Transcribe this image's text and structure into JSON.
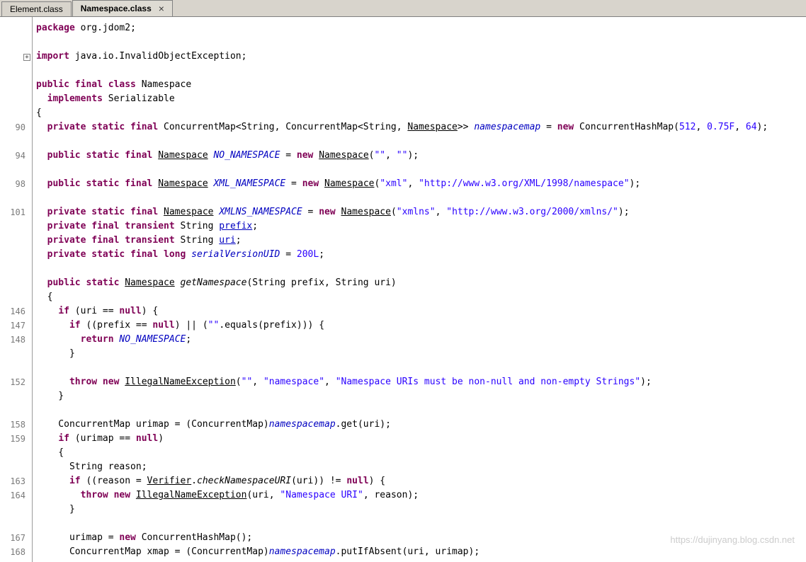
{
  "tabbar": {
    "tabs": [
      {
        "label": "Element.class",
        "active": false
      },
      {
        "label": "Namespace.class",
        "active": true
      }
    ],
    "close_glyph": "×"
  },
  "editor": {
    "expand_glyph": "+",
    "lines": [
      {
        "num": "",
        "segs": [
          {
            "s": "kw",
            "t": "package"
          },
          {
            "s": "pl",
            "t": " org.jdom2;"
          }
        ]
      },
      {
        "num": "",
        "segs": []
      },
      {
        "num": "",
        "segs": [
          {
            "s": "kw",
            "t": "import"
          },
          {
            "s": "pl",
            "t": " java.io.InvalidObjectException;"
          }
        ]
      },
      {
        "num": "",
        "segs": []
      },
      {
        "num": "",
        "segs": [
          {
            "s": "kw",
            "t": "public final class"
          },
          {
            "s": "pl",
            "t": " Namespace"
          }
        ]
      },
      {
        "num": "",
        "segs": [
          {
            "s": "pl",
            "t": "  "
          },
          {
            "s": "kw",
            "t": "implements"
          },
          {
            "s": "pl",
            "t": " Serializable"
          }
        ]
      },
      {
        "num": "",
        "segs": [
          {
            "s": "pl",
            "t": "{"
          }
        ]
      },
      {
        "num": "90",
        "segs": [
          {
            "s": "pl",
            "t": "  "
          },
          {
            "s": "kw",
            "t": "private static final"
          },
          {
            "s": "pl",
            "t": " ConcurrentMap<String, ConcurrentMap<String, "
          },
          {
            "s": "ty",
            "t": "Namespace"
          },
          {
            "s": "pl",
            "t": ">> "
          },
          {
            "s": "sf",
            "t": "namespacemap"
          },
          {
            "s": "pl",
            "t": " = "
          },
          {
            "s": "kw",
            "t": "new"
          },
          {
            "s": "pl",
            "t": " ConcurrentHashMap("
          },
          {
            "s": "num",
            "t": "512"
          },
          {
            "s": "pl",
            "t": ", "
          },
          {
            "s": "num",
            "t": "0.75F"
          },
          {
            "s": "pl",
            "t": ", "
          },
          {
            "s": "num",
            "t": "64"
          },
          {
            "s": "pl",
            "t": ");"
          }
        ]
      },
      {
        "num": "",
        "segs": []
      },
      {
        "num": "94",
        "segs": [
          {
            "s": "pl",
            "t": "  "
          },
          {
            "s": "kw",
            "t": "public static final"
          },
          {
            "s": "pl",
            "t": " "
          },
          {
            "s": "ty",
            "t": "Namespace"
          },
          {
            "s": "pl",
            "t": " "
          },
          {
            "s": "sf",
            "t": "NO_NAMESPACE"
          },
          {
            "s": "pl",
            "t": " = "
          },
          {
            "s": "kw",
            "t": "new"
          },
          {
            "s": "pl",
            "t": " "
          },
          {
            "s": "ty",
            "t": "Namespace"
          },
          {
            "s": "pl",
            "t": "("
          },
          {
            "s": "str",
            "t": "\"\""
          },
          {
            "s": "pl",
            "t": ", "
          },
          {
            "s": "str",
            "t": "\"\""
          },
          {
            "s": "pl",
            "t": ");"
          }
        ]
      },
      {
        "num": "",
        "segs": []
      },
      {
        "num": "98",
        "segs": [
          {
            "s": "pl",
            "t": "  "
          },
          {
            "s": "kw",
            "t": "public static final"
          },
          {
            "s": "pl",
            "t": " "
          },
          {
            "s": "ty",
            "t": "Namespace"
          },
          {
            "s": "pl",
            "t": " "
          },
          {
            "s": "sf",
            "t": "XML_NAMESPACE"
          },
          {
            "s": "pl",
            "t": " = "
          },
          {
            "s": "kw",
            "t": "new"
          },
          {
            "s": "pl",
            "t": " "
          },
          {
            "s": "ty",
            "t": "Namespace"
          },
          {
            "s": "pl",
            "t": "("
          },
          {
            "s": "str",
            "t": "\"xml\""
          },
          {
            "s": "pl",
            "t": ", "
          },
          {
            "s": "str",
            "t": "\"http://www.w3.org/XML/1998/namespace\""
          },
          {
            "s": "pl",
            "t": ");"
          }
        ]
      },
      {
        "num": "",
        "segs": []
      },
      {
        "num": "101",
        "segs": [
          {
            "s": "pl",
            "t": "  "
          },
          {
            "s": "kw",
            "t": "private static final"
          },
          {
            "s": "pl",
            "t": " "
          },
          {
            "s": "ty",
            "t": "Namespace"
          },
          {
            "s": "pl",
            "t": " "
          },
          {
            "s": "sf",
            "t": "XMLNS_NAMESPACE"
          },
          {
            "s": "pl",
            "t": " = "
          },
          {
            "s": "kw",
            "t": "new"
          },
          {
            "s": "pl",
            "t": " "
          },
          {
            "s": "ty",
            "t": "Namespace"
          },
          {
            "s": "pl",
            "t": "("
          },
          {
            "s": "str",
            "t": "\"xmlns\""
          },
          {
            "s": "pl",
            "t": ", "
          },
          {
            "s": "str",
            "t": "\"http://www.w3.org/2000/xmlns/\""
          },
          {
            "s": "pl",
            "t": ");"
          }
        ]
      },
      {
        "num": "",
        "segs": [
          {
            "s": "pl",
            "t": "  "
          },
          {
            "s": "kw",
            "t": "private final transient"
          },
          {
            "s": "pl",
            "t": " String "
          },
          {
            "s": "if",
            "t": "prefix"
          },
          {
            "s": "pl",
            "t": ";"
          }
        ]
      },
      {
        "num": "",
        "segs": [
          {
            "s": "pl",
            "t": "  "
          },
          {
            "s": "kw",
            "t": "private final transient"
          },
          {
            "s": "pl",
            "t": " String "
          },
          {
            "s": "if",
            "t": "uri"
          },
          {
            "s": "pl",
            "t": ";"
          }
        ]
      },
      {
        "num": "",
        "segs": [
          {
            "s": "pl",
            "t": "  "
          },
          {
            "s": "kw",
            "t": "private static final long"
          },
          {
            "s": "pl",
            "t": " "
          },
          {
            "s": "sf",
            "t": "serialVersionUID"
          },
          {
            "s": "pl",
            "t": " = "
          },
          {
            "s": "num",
            "t": "200L"
          },
          {
            "s": "pl",
            "t": ";"
          }
        ]
      },
      {
        "num": "",
        "segs": []
      },
      {
        "num": "",
        "segs": [
          {
            "s": "pl",
            "t": "  "
          },
          {
            "s": "kw",
            "t": "public static"
          },
          {
            "s": "pl",
            "t": " "
          },
          {
            "s": "ty",
            "t": "Namespace"
          },
          {
            "s": "pl",
            "t": " "
          },
          {
            "s": "sm",
            "t": "getNamespace"
          },
          {
            "s": "pl",
            "t": "(String prefix, String uri)"
          }
        ]
      },
      {
        "num": "",
        "segs": [
          {
            "s": "pl",
            "t": "  {"
          }
        ]
      },
      {
        "num": "146",
        "segs": [
          {
            "s": "pl",
            "t": "    "
          },
          {
            "s": "kw",
            "t": "if"
          },
          {
            "s": "pl",
            "t": " (uri == "
          },
          {
            "s": "kw",
            "t": "null"
          },
          {
            "s": "pl",
            "t": ") {"
          }
        ]
      },
      {
        "num": "147",
        "segs": [
          {
            "s": "pl",
            "t": "      "
          },
          {
            "s": "kw",
            "t": "if"
          },
          {
            "s": "pl",
            "t": " ((prefix == "
          },
          {
            "s": "kw",
            "t": "null"
          },
          {
            "s": "pl",
            "t": ") || ("
          },
          {
            "s": "str",
            "t": "\"\""
          },
          {
            "s": "pl",
            "t": ".equals(prefix))) {"
          }
        ]
      },
      {
        "num": "148",
        "segs": [
          {
            "s": "pl",
            "t": "        "
          },
          {
            "s": "kw",
            "t": "return"
          },
          {
            "s": "pl",
            "t": " "
          },
          {
            "s": "sf",
            "t": "NO_NAMESPACE"
          },
          {
            "s": "pl",
            "t": ";"
          }
        ]
      },
      {
        "num": "",
        "segs": [
          {
            "s": "pl",
            "t": "      }"
          }
        ]
      },
      {
        "num": "",
        "segs": []
      },
      {
        "num": "152",
        "segs": [
          {
            "s": "pl",
            "t": "      "
          },
          {
            "s": "kw",
            "t": "throw new"
          },
          {
            "s": "pl",
            "t": " "
          },
          {
            "s": "ty",
            "t": "IllegalNameException"
          },
          {
            "s": "pl",
            "t": "("
          },
          {
            "s": "str",
            "t": "\"\""
          },
          {
            "s": "pl",
            "t": ", "
          },
          {
            "s": "str",
            "t": "\"namespace\""
          },
          {
            "s": "pl",
            "t": ", "
          },
          {
            "s": "str",
            "t": "\"Namespace URIs must be non-null and non-empty Strings\""
          },
          {
            "s": "pl",
            "t": ");"
          }
        ]
      },
      {
        "num": "",
        "segs": [
          {
            "s": "pl",
            "t": "    }"
          }
        ]
      },
      {
        "num": "",
        "segs": []
      },
      {
        "num": "158",
        "segs": [
          {
            "s": "pl",
            "t": "    ConcurrentMap urimap = (ConcurrentMap)"
          },
          {
            "s": "sf",
            "t": "namespacemap"
          },
          {
            "s": "pl",
            "t": ".get(uri);"
          }
        ]
      },
      {
        "num": "159",
        "segs": [
          {
            "s": "pl",
            "t": "    "
          },
          {
            "s": "kw",
            "t": "if"
          },
          {
            "s": "pl",
            "t": " (urimap == "
          },
          {
            "s": "kw",
            "t": "null"
          },
          {
            "s": "pl",
            "t": ")"
          }
        ]
      },
      {
        "num": "",
        "segs": [
          {
            "s": "pl",
            "t": "    {"
          }
        ]
      },
      {
        "num": "",
        "segs": [
          {
            "s": "pl",
            "t": "      String reason;"
          }
        ]
      },
      {
        "num": "163",
        "segs": [
          {
            "s": "pl",
            "t": "      "
          },
          {
            "s": "kw",
            "t": "if"
          },
          {
            "s": "pl",
            "t": " ((reason = "
          },
          {
            "s": "ty",
            "t": "Verifier"
          },
          {
            "s": "pl",
            "t": "."
          },
          {
            "s": "sm",
            "t": "checkNamespaceURI"
          },
          {
            "s": "pl",
            "t": "(uri)) != "
          },
          {
            "s": "kw",
            "t": "null"
          },
          {
            "s": "pl",
            "t": ") {"
          }
        ]
      },
      {
        "num": "164",
        "segs": [
          {
            "s": "pl",
            "t": "        "
          },
          {
            "s": "kw",
            "t": "throw new"
          },
          {
            "s": "pl",
            "t": " "
          },
          {
            "s": "ty",
            "t": "IllegalNameException"
          },
          {
            "s": "pl",
            "t": "(uri, "
          },
          {
            "s": "str",
            "t": "\"Namespace URI\""
          },
          {
            "s": "pl",
            "t": ", reason);"
          }
        ]
      },
      {
        "num": "",
        "segs": [
          {
            "s": "pl",
            "t": "      }"
          }
        ]
      },
      {
        "num": "",
        "segs": []
      },
      {
        "num": "167",
        "segs": [
          {
            "s": "pl",
            "t": "      urimap = "
          },
          {
            "s": "kw",
            "t": "new"
          },
          {
            "s": "pl",
            "t": " ConcurrentHashMap();"
          }
        ]
      },
      {
        "num": "168",
        "segs": [
          {
            "s": "pl",
            "t": "      ConcurrentMap xmap = (ConcurrentMap)"
          },
          {
            "s": "sf",
            "t": "namespacemap"
          },
          {
            "s": "pl",
            "t": ".putIfAbsent(uri, urimap);"
          }
        ]
      }
    ]
  },
  "watermark": "https://dujinyang.blog.csdn.net"
}
